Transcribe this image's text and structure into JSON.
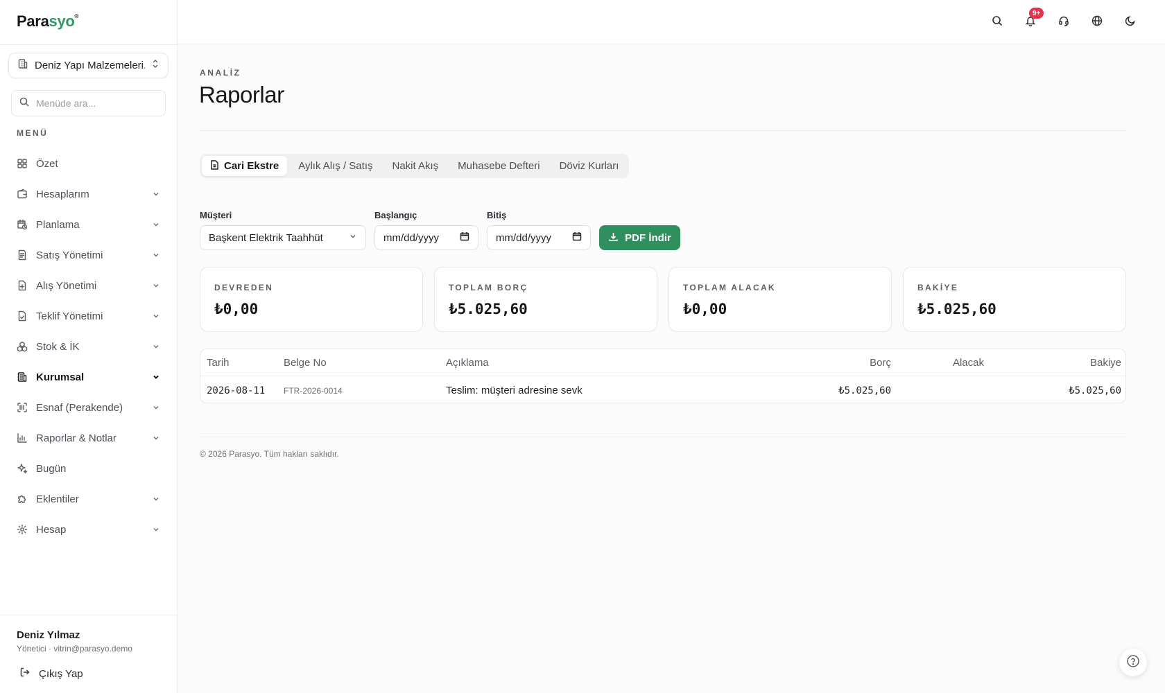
{
  "brand": {
    "name_dark": "Para",
    "name_accent": "syo",
    "reg": "®"
  },
  "company": {
    "name": "Deniz Yapı Malzemeleri..."
  },
  "sidebar_search": {
    "placeholder": "Menüde ara..."
  },
  "menu": {
    "title": "MENÜ",
    "items": [
      {
        "label": "Özet",
        "icon": "grid-icon",
        "expandable": false
      },
      {
        "label": "Hesaplarım",
        "icon": "wallet-icon",
        "expandable": true
      },
      {
        "label": "Planlama",
        "icon": "calendar-clock-icon",
        "expandable": true
      },
      {
        "label": "Satış Yönetimi",
        "icon": "receipt-icon",
        "expandable": true
      },
      {
        "label": "Alış Yönetimi",
        "icon": "file-plus-icon",
        "expandable": true
      },
      {
        "label": "Teklif Yönetimi",
        "icon": "file-check-icon",
        "expandable": true
      },
      {
        "label": "Stok & İK",
        "icon": "boxes-icon",
        "expandable": true
      },
      {
        "label": "Kurumsal",
        "icon": "building-icon",
        "expandable": true,
        "active": true
      },
      {
        "label": "Esnaf (Perakende)",
        "icon": "scan-icon",
        "expandable": true
      },
      {
        "label": "Raporlar & Notlar",
        "icon": "bar-chart-icon",
        "expandable": true
      },
      {
        "label": "Bugün",
        "icon": "sparkles-icon",
        "expandable": false
      },
      {
        "label": "Eklentiler",
        "icon": "puzzle-icon",
        "expandable": true
      },
      {
        "label": "Hesap",
        "icon": "settings-icon",
        "expandable": true
      }
    ]
  },
  "user": {
    "name": "Deniz Yılmaz",
    "role_email": "Yönetici · vitrin@parasyo.demo",
    "logout": "Çıkış Yap"
  },
  "topbar": {
    "notification_badge": "9+"
  },
  "page": {
    "eyebrow": "ANALİZ",
    "title": "Raporlar"
  },
  "tabs": [
    {
      "label": "Cari Ekstre",
      "active": true
    },
    {
      "label": "Aylık Alış / Satış",
      "active": false
    },
    {
      "label": "Nakit Akış",
      "active": false
    },
    {
      "label": "Muhasebe Defteri",
      "active": false
    },
    {
      "label": "Döviz Kurları",
      "active": false
    }
  ],
  "filters": {
    "customer_label": "Müşteri",
    "customer_value": "Başkent Elektrik Taahhüt",
    "start_label": "Başlangıç",
    "start_value": "mm/dd/yyyy",
    "end_label": "Bitiş",
    "end_value": "mm/dd/yyyy",
    "pdf_button": "PDF İndir"
  },
  "summary": [
    {
      "label": "DEVREDEN",
      "value": "₺0,00"
    },
    {
      "label": "TOPLAM BORÇ",
      "value": "₺5.025,60"
    },
    {
      "label": "TOPLAM ALACAK",
      "value": "₺0,00"
    },
    {
      "label": "BAKİYE",
      "value": "₺5.025,60"
    }
  ],
  "table": {
    "headers": {
      "date": "Tarih",
      "doc": "Belge No",
      "desc": "Açıklama",
      "debit": "Borç",
      "credit": "Alacak",
      "balance": "Bakiye"
    },
    "rows": [
      {
        "date": "2026-08-11",
        "doc": "FTR-2026-0014",
        "desc": "Teslim: müşteri adresine sevk",
        "debit": "₺5.025,60",
        "credit": "",
        "balance": "₺5.025,60"
      }
    ]
  },
  "footer": {
    "text": "© 2026 Parasyo. Tüm hakları saklıdır."
  },
  "colors": {
    "accent": "#2f8f5f",
    "badge": "#e0344f"
  }
}
